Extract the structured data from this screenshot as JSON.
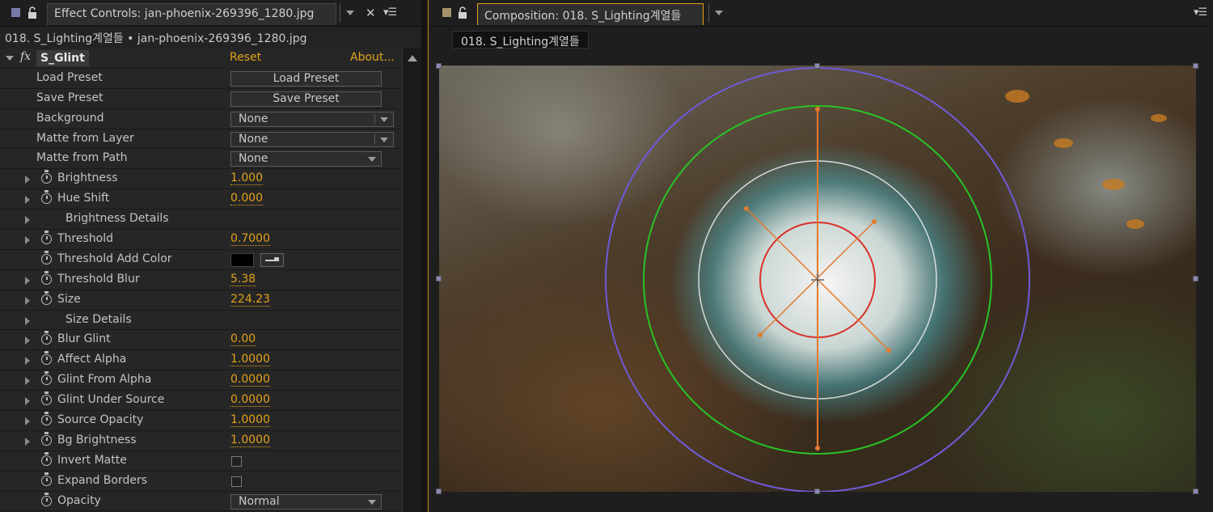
{
  "effect_controls": {
    "tab_title": "Effect Controls: jan-phoenix-269396_1280.jpg",
    "sub_header": "018. S_Lighting계열들 • jan-phoenix-269396_1280.jpg",
    "effect": {
      "fx_label": "fx",
      "name": "S_Glint",
      "reset": "Reset",
      "about": "About..."
    },
    "rows": {
      "load_preset": {
        "label": "Load Preset",
        "button": "Load Preset"
      },
      "save_preset": {
        "label": "Save Preset",
        "button": "Save Preset"
      },
      "background": {
        "label": "Background",
        "value": "None"
      },
      "matte_from_layer": {
        "label": "Matte from Layer",
        "value": "None"
      },
      "matte_from_path": {
        "label": "Matte from Path",
        "value": "None"
      },
      "brightness": {
        "label": "Brightness",
        "value": "1.000"
      },
      "hue_shift": {
        "label": "Hue Shift",
        "value": "0.000"
      },
      "brightness_details": {
        "label": "Brightness Details"
      },
      "threshold": {
        "label": "Threshold",
        "value": "0.7000"
      },
      "threshold_add_color": {
        "label": "Threshold Add Color"
      },
      "threshold_blur": {
        "label": "Threshold Blur",
        "value": "5.38"
      },
      "size": {
        "label": "Size",
        "value": "224.23"
      },
      "size_details": {
        "label": "Size Details"
      },
      "blur_glint": {
        "label": "Blur Glint",
        "value": "0.00"
      },
      "affect_alpha": {
        "label": "Affect Alpha",
        "value": "1.0000"
      },
      "glint_from_alpha": {
        "label": "Glint From Alpha",
        "value": "0.0000"
      },
      "glint_under_source": {
        "label": "Glint Under Source",
        "value": "0.0000"
      },
      "source_opacity": {
        "label": "Source Opacity",
        "value": "1.0000"
      },
      "bg_brightness": {
        "label": "Bg Brightness",
        "value": "1.0000"
      },
      "invert_matte": {
        "label": "Invert Matte",
        "checked": false
      },
      "expand_borders": {
        "label": "Expand Borders",
        "checked": false
      },
      "opacity": {
        "label": "Opacity",
        "value": "Normal"
      }
    }
  },
  "composition": {
    "tab_title": "Composition: 018. S_Lighting계열들",
    "breadcrumb": "018. S_Lighting계열들"
  },
  "colors": {
    "accent_orange": "#e3a21a",
    "guide_blue": "#6e5bd8",
    "guide_green": "#27c427",
    "guide_red": "#d9302a",
    "guide_orange": "#e27a30"
  }
}
